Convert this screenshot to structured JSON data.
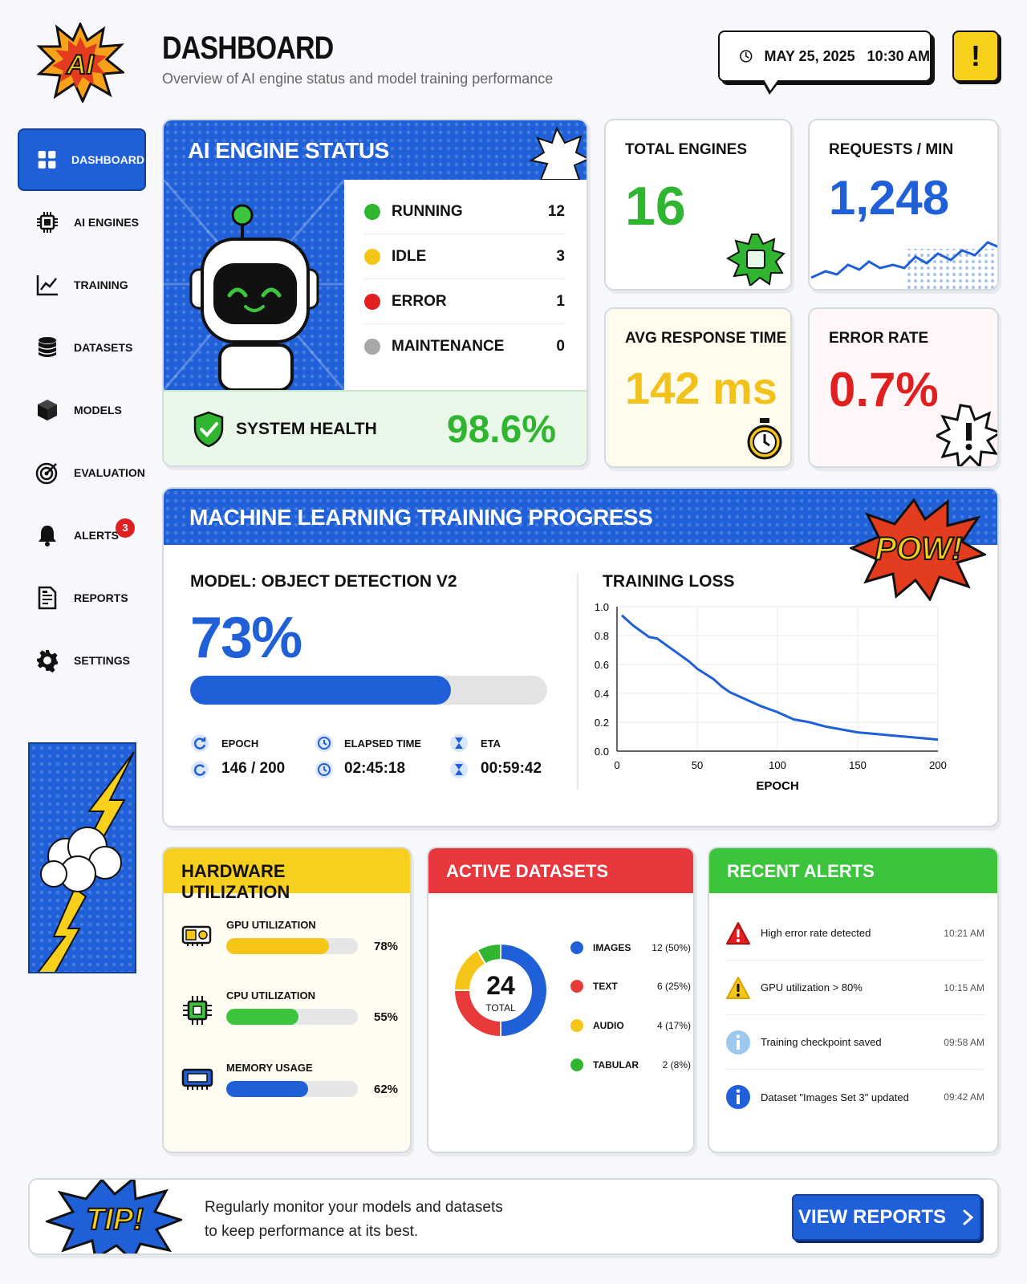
{
  "header": {
    "logo_text": "AI",
    "title": "DASHBOARD",
    "subtitle": "Overview of AI engine status and model training performance",
    "datetime": "MAY 25, 2025   10:30 AM",
    "alert_glyph": "!"
  },
  "sidebar": {
    "items": [
      {
        "label": "DASHBOARD",
        "icon": "grid-icon",
        "active": true
      },
      {
        "label": "AI ENGINES",
        "icon": "chip-icon"
      },
      {
        "label": "TRAINING",
        "icon": "line-chart-icon"
      },
      {
        "label": "DATASETS",
        "icon": "database-icon"
      },
      {
        "label": "MODELS",
        "icon": "cube-icon"
      },
      {
        "label": "EVALUATION",
        "icon": "target-icon"
      },
      {
        "label": "ALERTS",
        "icon": "bell-icon",
        "badge": "3"
      },
      {
        "label": "REPORTS",
        "icon": "report-icon"
      },
      {
        "label": "SETTINGS",
        "icon": "gear-icon"
      }
    ]
  },
  "engine_status": {
    "title": "AI ENGINE STATUS",
    "rows": [
      {
        "label": "RUNNING",
        "value": "12",
        "color": "#2fb52f"
      },
      {
        "label": "IDLE",
        "value": "3",
        "color": "#f5c518"
      },
      {
        "label": "ERROR",
        "value": "1",
        "color": "#e02020"
      },
      {
        "label": "MAINTENANCE",
        "value": "0",
        "color": "#a8a8a8"
      }
    ],
    "health_label": "SYSTEM HEALTH",
    "health_value": "98.6%"
  },
  "stats": {
    "total_engines": {
      "label": "TOTAL ENGINES",
      "value": "16",
      "color": "#2fb52f"
    },
    "requests": {
      "label": "REQUESTS / MIN",
      "value": "1,248",
      "color": "#1f5fd8"
    },
    "avg_response": {
      "label": "AVG RESPONSE TIME",
      "value": "142 ms",
      "color": "#f2c21a"
    },
    "error_rate": {
      "label": "ERROR RATE",
      "value": "0.7%",
      "color": "#e02020"
    }
  },
  "training": {
    "title": "MACHINE LEARNING TRAINING PROGRESS",
    "pow": "POW!",
    "model_label": "MODEL: OBJECT DETECTION V2",
    "progress_pct": "73%",
    "progress_fraction": 0.73,
    "epoch_label": "EPOCH",
    "epoch_value": "146 / 200",
    "elapsed_label": "ELAPSED TIME",
    "elapsed_value": "02:45:18",
    "eta_label": "ETA",
    "eta_value": "00:59:42"
  },
  "chart_data": {
    "type": "line",
    "title": "TRAINING LOSS",
    "xlabel": "EPOCH",
    "ylabel": "",
    "xlim": [
      0,
      200
    ],
    "ylim": [
      0,
      1.0
    ],
    "xticks": [
      "0",
      "50",
      "100",
      "150",
      "200"
    ],
    "yticks": [
      "0.0",
      "0.2",
      "0.4",
      "0.6",
      "0.8",
      "1.0"
    ],
    "grid": true,
    "color": "#1f5fd8",
    "x": [
      3,
      10,
      15,
      20,
      25,
      30,
      40,
      45,
      50,
      60,
      65,
      70,
      80,
      90,
      100,
      110,
      120,
      130,
      140,
      150,
      160,
      170,
      180,
      190,
      200
    ],
    "y": [
      0.94,
      0.87,
      0.83,
      0.79,
      0.78,
      0.74,
      0.66,
      0.62,
      0.57,
      0.5,
      0.45,
      0.41,
      0.36,
      0.31,
      0.27,
      0.22,
      0.2,
      0.17,
      0.15,
      0.13,
      0.12,
      0.11,
      0.1,
      0.09,
      0.08
    ]
  },
  "hardware": {
    "title": "HARDWARE UTILIZATION",
    "rows": [
      {
        "label": "GPU UTILIZATION",
        "value": "78%",
        "fraction": 0.78,
        "color": "#f5c518",
        "icon": "gpu-icon"
      },
      {
        "label": "CPU UTILIZATION",
        "value": "55%",
        "fraction": 0.55,
        "color": "#3cc43c",
        "icon": "cpu-icon"
      },
      {
        "label": "MEMORY USAGE",
        "value": "62%",
        "fraction": 0.62,
        "color": "#1f5fd8",
        "icon": "memory-icon"
      }
    ]
  },
  "datasets": {
    "title": "ACTIVE DATASETS",
    "total": "24",
    "total_label": "TOTAL",
    "rows": [
      {
        "label": "IMAGES",
        "count": "12 (50%)",
        "value": 12,
        "color": "#1f5fd8"
      },
      {
        "label": "TEXT",
        "count": "6 (25%)",
        "value": 6,
        "color": "#e83a3a"
      },
      {
        "label": "AUDIO",
        "count": "4 (17%)",
        "value": 4,
        "color": "#f5c518"
      },
      {
        "label": "TABULAR",
        "count": "2 (8%)",
        "value": 2,
        "color": "#2fb52f"
      }
    ]
  },
  "alerts": {
    "title": "RECENT ALERTS",
    "rows": [
      {
        "message": "High error rate detected",
        "time": "10:21 AM",
        "icon": "error-triangle-icon",
        "color": "#e02020"
      },
      {
        "message": "GPU utilization > 80%",
        "time": "10:15 AM",
        "icon": "warning-triangle-icon",
        "color": "#f5c518"
      },
      {
        "message": "Training checkpoint saved",
        "time": "09:58 AM",
        "icon": "info-icon",
        "color": "#9cc8ee"
      },
      {
        "message": "Dataset \"Images Set 3\" updated",
        "time": "09:42 AM",
        "icon": "info-icon",
        "color": "#1f5fd8"
      }
    ]
  },
  "tip": {
    "badge": "TIP!",
    "line1": "Regularly monitor your models and datasets",
    "line2": "to keep performance at its best.",
    "button": "VIEW REPORTS"
  }
}
